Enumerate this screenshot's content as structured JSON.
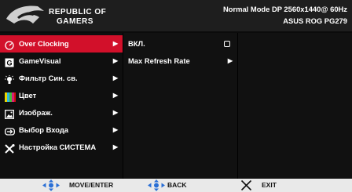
{
  "header": {
    "brand_line1": "REPUBLIC OF",
    "brand_line2": "GAMERS",
    "status_line1": "Normal Mode DP 2560x1440@ 60Hz",
    "status_line2": "ASUS ROG PG279"
  },
  "menu": {
    "items": [
      {
        "label": "Over Clocking",
        "icon": "speedometer-icon",
        "selected": true
      },
      {
        "label": "GameVisual",
        "icon": "gamevisual-icon",
        "selected": false
      },
      {
        "label": "Фильтр Син. св.",
        "icon": "bulb-icon",
        "selected": false
      },
      {
        "label": "Цвет",
        "icon": "color-bars-icon",
        "selected": false
      },
      {
        "label": "Изображ.",
        "icon": "picture-icon",
        "selected": false
      },
      {
        "label": "Выбор Входа",
        "icon": "input-arrow-icon",
        "selected": false
      },
      {
        "label": "Настройка СИСТЕМА",
        "icon": "tools-icon",
        "selected": false
      }
    ]
  },
  "submenu": {
    "items": [
      {
        "label": "ВКЛ.",
        "control": "checkbox",
        "checked": false
      },
      {
        "label": "Max Refresh Rate",
        "control": "arrow"
      }
    ]
  },
  "footer": {
    "move_label": "MOVE/ENTER",
    "back_label": "BACK",
    "exit_label": "EXIT"
  },
  "colors": {
    "accent": "#d2102a",
    "dpad": "#2a6fd6",
    "footer_bg": "#e9e9e9"
  }
}
